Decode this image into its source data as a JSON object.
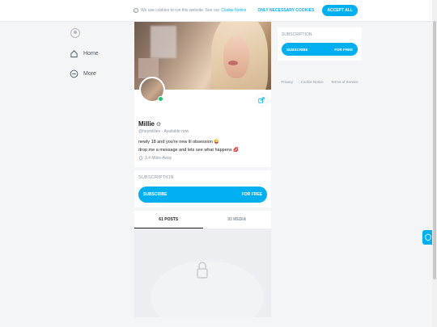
{
  "cookie": {
    "text": "We use cookies to run this website. See our",
    "link": "Cookie Notice",
    "only_necessary": "ONLY NECESSARY COOKIES",
    "accept": "ACCEPT ALL"
  },
  "nav": {
    "items": [
      {
        "label": "Home",
        "icon": "home-icon"
      },
      {
        "label": "More",
        "icon": "more-icon"
      }
    ]
  },
  "profile": {
    "name": "Millie",
    "handle": "@heymillieo",
    "status": "Available now",
    "bio_line1": "newly 18 and you're new lil obsession 😜",
    "bio_line2": "drop me a message and lets see what happens 💋",
    "distance": "3.4 Miles Away"
  },
  "subscription": {
    "title": "SUBSCRIPTION",
    "button_label": "SUBSCRIBE",
    "button_price": "FOR FREE"
  },
  "tabs": [
    {
      "label": "61 POSTS",
      "active": true
    },
    {
      "label": "93 MEDIA",
      "active": false
    }
  ],
  "right": {
    "title": "SUBSCRIPTION",
    "button_label": "SUBSCRIBE",
    "button_price": "FOR FREE",
    "footer": [
      "Privacy",
      "Cookie Notice",
      "Terms of Service"
    ]
  },
  "colors": {
    "accent": "#00aff0",
    "online": "#1ec86a"
  }
}
